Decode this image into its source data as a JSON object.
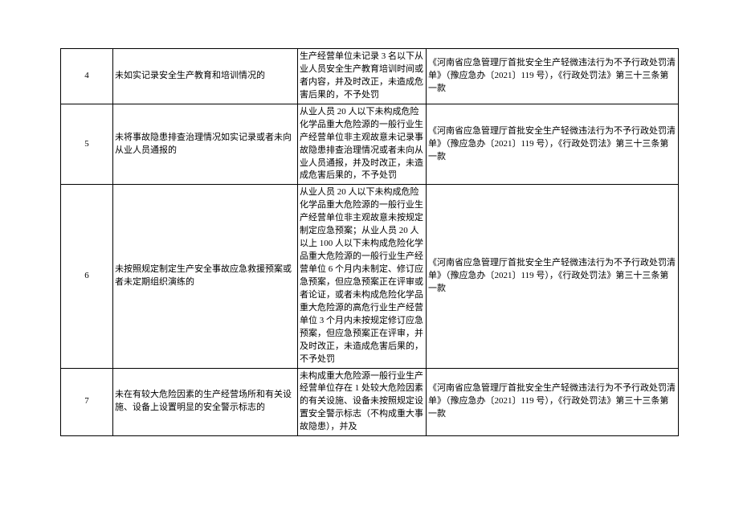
{
  "rows": [
    {
      "num": "4",
      "behavior": "未如实记录安全生产教育和培训情况的",
      "condition": "生产经营单位未记录 3 名以下从业人员安全生产教育培训时间或者内容，并及时改正，未造成危害后果的，不予处罚",
      "basis": "《河南省应急管理厅首批安全生产轻微违法行为不予行政处罚清单》（豫应急办〔2021〕119 号），《行政处罚法》第三十三条第一款"
    },
    {
      "num": "5",
      "behavior": "未将事故隐患排查治理情况如实记录或者未向从业人员通报的",
      "condition": "从业人员 20 人以下未构成危险化学品重大危险源的一般行业生产经营单位非主观故意未记录事故隐患排查治理情况或者未向从业人员通报，并及时改正，未造成危害后果的，不予处罚",
      "basis": "《河南省应急管理厅首批安全生产轻微违法行为不予行政处罚清单》（豫应急办〔2021〕119 号），《行政处罚法》第三十三条第一款"
    },
    {
      "num": "6",
      "behavior": "未按照规定制定生产安全事故应急救援预案或者未定期组织演练的",
      "condition": "从业人员 20 人以下未构成危险化学品重大危险源的一般行业生产经营单位非主观故意未按规定制定应急预案；从业人员 20 人以上 100 人以下未构成危险化学品重大危险源的一般行业生产经营单位 6 个月内未制定、修订应急预案，但应急预案正在评审或者论证，或者未构成危险化学品重大危险源的高危行业生产经营单位 3 个月内未按规定修订应急预案，但应急预案正在评审，并及时改正，未造成危害后果的，不予处罚",
      "basis": "《河南省应急管理厅首批安全生产轻微违法行为不予行政处罚清单》（豫应急办〔2021〕119 号），《行政处罚法》第三十三条第一款"
    },
    {
      "num": "7",
      "behavior": "未在有较大危险因素的生产经营场所和有关设施、设备上设置明显的安全警示标志的",
      "condition": "未构成重大危险源一般行业生产经营单位存在 1 处较大危险因素的有关设施、设备未按照规定设置安全警示标志（不构成重大事故隐患），并及",
      "basis": "《河南省应急管理厅首批安全生产轻微违法行为不予行政处罚清单》（豫应急办〔2021〕119 号），《行政处罚法》第三十三条第一款"
    }
  ]
}
